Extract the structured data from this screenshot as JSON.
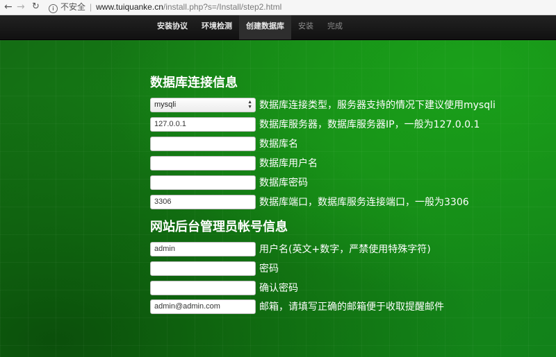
{
  "browser": {
    "security_label": "不安全",
    "url_host": "www.tuiquanke.cn",
    "url_path": "/install.php?s=/Install/step2.html"
  },
  "nav": {
    "items": [
      {
        "label": "安装协议",
        "state": "done"
      },
      {
        "label": "环境检测",
        "state": "done"
      },
      {
        "label": "创建数据库",
        "state": "active"
      },
      {
        "label": "安装",
        "state": "inactive"
      },
      {
        "label": "完成",
        "state": "inactive"
      }
    ]
  },
  "db_section": {
    "title": "数据库连接信息",
    "db_type": {
      "value": "mysqli",
      "label": "数据库连接类型，服务器支持的情况下建议使用mysqli"
    },
    "db_host": {
      "value": "127.0.0.1",
      "label": "数据库服务器，数据库服务器IP，一般为127.0.0.1"
    },
    "db_name": {
      "value": "",
      "label": "数据库名"
    },
    "db_user": {
      "value": "",
      "label": "数据库用户名"
    },
    "db_pass": {
      "value": "",
      "label": "数据库密码"
    },
    "db_port": {
      "value": "3306",
      "label": "数据库端口，数据库服务连接端口，一般为3306"
    }
  },
  "admin_section": {
    "title": "网站后台管理员帐号信息",
    "username": {
      "value": "admin",
      "label": "用户名(英文+数字，严禁使用特殊字符)"
    },
    "password": {
      "value": "",
      "label": "密码"
    },
    "confirm_password": {
      "value": "",
      "label": "确认密码"
    },
    "email": {
      "value": "admin@admin.com",
      "label": "邮箱，请填写正确的邮箱便于收取提醒邮件"
    }
  }
}
